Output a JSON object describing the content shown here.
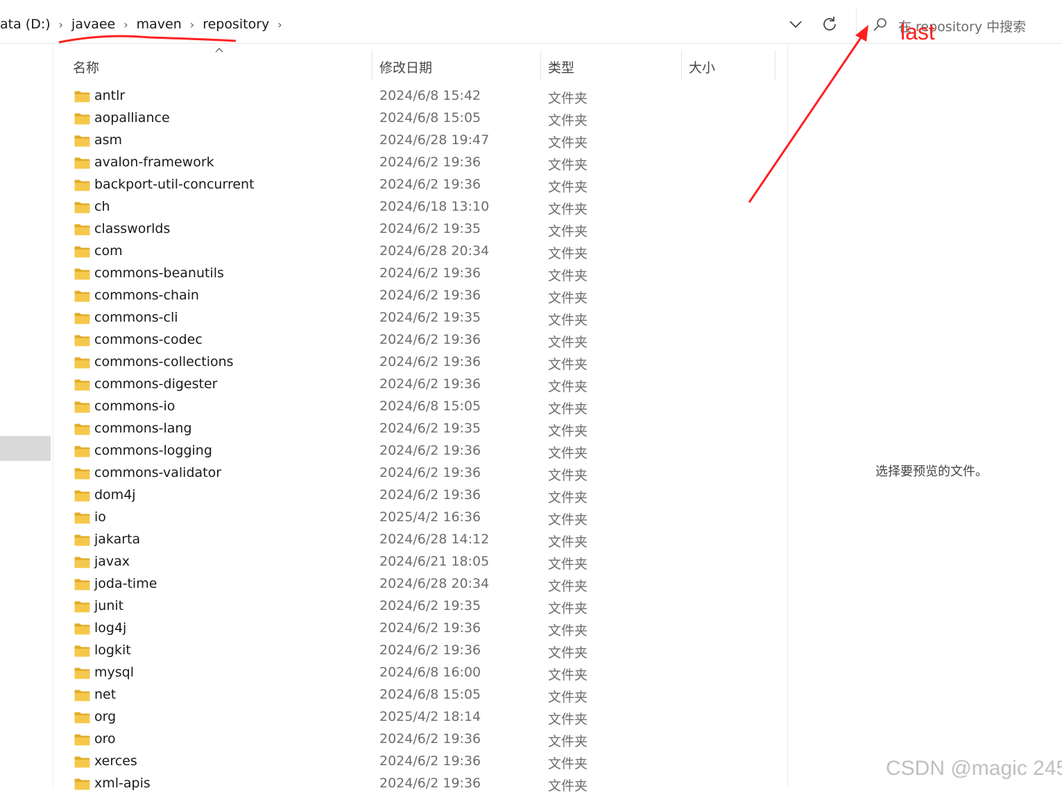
{
  "address_bar": {
    "breadcrumbs": [
      "ata (D:)",
      "javaee",
      "maven",
      "repository"
    ],
    "separator": "›"
  },
  "search": {
    "placeholder": "在 repository 中搜索"
  },
  "columns": {
    "name": "名称",
    "modified": "修改日期",
    "type": "类型",
    "size": "大小"
  },
  "files": [
    {
      "name": "antlr",
      "modified": "2024/6/8 15:42",
      "type": "文件夹"
    },
    {
      "name": "aopalliance",
      "modified": "2024/6/8 15:05",
      "type": "文件夹"
    },
    {
      "name": "asm",
      "modified": "2024/6/28 19:47",
      "type": "文件夹"
    },
    {
      "name": "avalon-framework",
      "modified": "2024/6/2 19:36",
      "type": "文件夹"
    },
    {
      "name": "backport-util-concurrent",
      "modified": "2024/6/2 19:36",
      "type": "文件夹"
    },
    {
      "name": "ch",
      "modified": "2024/6/18 13:10",
      "type": "文件夹"
    },
    {
      "name": "classworlds",
      "modified": "2024/6/2 19:35",
      "type": "文件夹"
    },
    {
      "name": "com",
      "modified": "2024/6/28 20:34",
      "type": "文件夹"
    },
    {
      "name": "commons-beanutils",
      "modified": "2024/6/2 19:36",
      "type": "文件夹"
    },
    {
      "name": "commons-chain",
      "modified": "2024/6/2 19:36",
      "type": "文件夹"
    },
    {
      "name": "commons-cli",
      "modified": "2024/6/2 19:35",
      "type": "文件夹"
    },
    {
      "name": "commons-codec",
      "modified": "2024/6/2 19:36",
      "type": "文件夹"
    },
    {
      "name": "commons-collections",
      "modified": "2024/6/2 19:36",
      "type": "文件夹"
    },
    {
      "name": "commons-digester",
      "modified": "2024/6/2 19:36",
      "type": "文件夹"
    },
    {
      "name": "commons-io",
      "modified": "2024/6/8 15:05",
      "type": "文件夹"
    },
    {
      "name": "commons-lang",
      "modified": "2024/6/2 19:35",
      "type": "文件夹"
    },
    {
      "name": "commons-logging",
      "modified": "2024/6/2 19:36",
      "type": "文件夹"
    },
    {
      "name": "commons-validator",
      "modified": "2024/6/2 19:36",
      "type": "文件夹"
    },
    {
      "name": "dom4j",
      "modified": "2024/6/2 19:36",
      "type": "文件夹"
    },
    {
      "name": "io",
      "modified": "2025/4/2 16:36",
      "type": "文件夹"
    },
    {
      "name": "jakarta",
      "modified": "2024/6/28 14:12",
      "type": "文件夹"
    },
    {
      "name": "javax",
      "modified": "2024/6/21 18:05",
      "type": "文件夹"
    },
    {
      "name": "joda-time",
      "modified": "2024/6/28 20:34",
      "type": "文件夹"
    },
    {
      "name": "junit",
      "modified": "2024/6/2 19:35",
      "type": "文件夹"
    },
    {
      "name": "log4j",
      "modified": "2024/6/2 19:36",
      "type": "文件夹"
    },
    {
      "name": "logkit",
      "modified": "2024/6/2 19:36",
      "type": "文件夹"
    },
    {
      "name": "mysql",
      "modified": "2024/6/8 16:00",
      "type": "文件夹"
    },
    {
      "name": "net",
      "modified": "2024/6/8 15:05",
      "type": "文件夹"
    },
    {
      "name": "org",
      "modified": "2025/4/2 18:14",
      "type": "文件夹"
    },
    {
      "name": "oro",
      "modified": "2024/6/2 19:36",
      "type": "文件夹"
    },
    {
      "name": "xerces",
      "modified": "2024/6/2 19:36",
      "type": "文件夹"
    },
    {
      "name": "xml-apis",
      "modified": "2024/6/2 19:36",
      "type": "文件夹"
    }
  ],
  "preview": {
    "message": "选择要预览的文件。"
  },
  "annotations": {
    "arrow_label": "last",
    "color": "#ff2020"
  },
  "watermark": "CSDN @magic 245",
  "colors": {
    "folder": "#f5c84c",
    "folder_dark": "#e2ad2a",
    "selection": "#d9d9d9"
  },
  "icons": [
    "chevron-down-icon",
    "refresh-icon",
    "search-icon",
    "folder-icon",
    "sort-up-icon"
  ]
}
